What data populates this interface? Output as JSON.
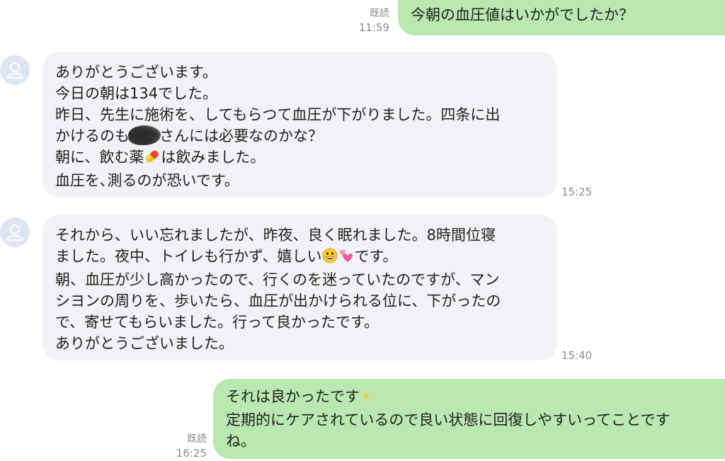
{
  "messages": [
    {
      "id": "m1",
      "sender": "me",
      "read_label": "既読",
      "time": "11:59",
      "lines": [
        "今朝の血圧値はいかがでしたか？"
      ]
    },
    {
      "id": "m2",
      "sender": "other",
      "time": "15:25",
      "lines": [
        "ありがとうございます。",
        "今日の朝は134でした。",
        "昨日、先生に施術を、してもらつて血圧が下がりました。四条に出",
        "かけるのも",
        "さんには必要なのかな？",
        "朝に、飲む薬",
        "は飲みました。",
        "血圧を､測るのが恐いです。"
      ]
    },
    {
      "id": "m3",
      "sender": "other",
      "time": "15:40",
      "lines": [
        "それから、いい忘れましたが、昨夜、良く眠れました。8時間位寝",
        "ました。夜中、トイレも行かず、嬉しい",
        "です。",
        "朝、血圧が少し高かったので、行くのを迷っていたのですが、マン",
        "シヨンの周りを、歩いたら、血圧が出かけられる位に、下がったの",
        "で、寄せてもらいました。行って良かったです。",
        "ありがとうございました。"
      ]
    },
    {
      "id": "m4",
      "sender": "me",
      "read_label": "既読",
      "time": "16:25",
      "lines": [
        "それは良かったです",
        "定期的にケアされているので良い状態に回復しやすいってことです",
        "ね。"
      ]
    }
  ],
  "icons": {
    "avatar": "default-user-avatar-icon",
    "pill": "pill-emoji-icon",
    "smile": "grinning-face-emoji-icon",
    "hearts": "revolving-hearts-emoji-icon",
    "sparkles": "sparkles-emoji-icon"
  },
  "colors": {
    "incoming_bubble": "#f1f2f5",
    "outgoing_bubble": "#b9e8b0",
    "meta_text": "#8a8a8a",
    "avatar_bg": "#dfe4f3"
  }
}
